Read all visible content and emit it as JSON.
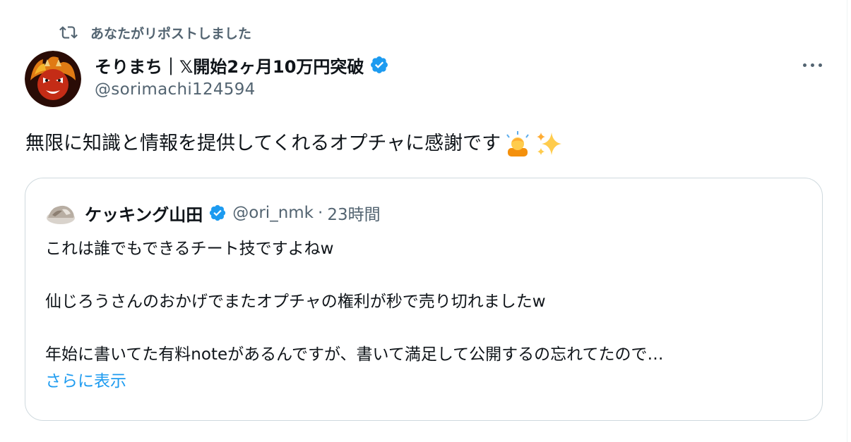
{
  "repost": {
    "icon": "repost-icon",
    "label": "あなたがリポストしました"
  },
  "tweet": {
    "author": {
      "name": "そりまち｜𝕏開始2ヶ月10万円突破",
      "handle": "@sorimachi124594",
      "verified": true
    },
    "text": "無限に知識と情報を提供してくれるオプチャに感謝です",
    "emojis": [
      "bowing-person-emoji",
      "sparkles-emoji"
    ],
    "more_icon": "more-icon"
  },
  "quote": {
    "author": {
      "name": "ケッキング山田",
      "handle": "@ori_nmk",
      "verified": true
    },
    "separator": "·",
    "time": "23時間",
    "lines": [
      "これは誰でもできるチート技ですよねw",
      "仙じろうさんのおかげでまたオプチャの権利が秒で売り切れましたw",
      "年始に書いてた有料noteがあるんですが、書いて満足して公開するの忘れてたので…"
    ],
    "show_more": "さらに表示"
  },
  "colors": {
    "text": "#0f1419",
    "secondary": "#536471",
    "accent": "#1d9bf0",
    "border": "#cfd9de"
  }
}
